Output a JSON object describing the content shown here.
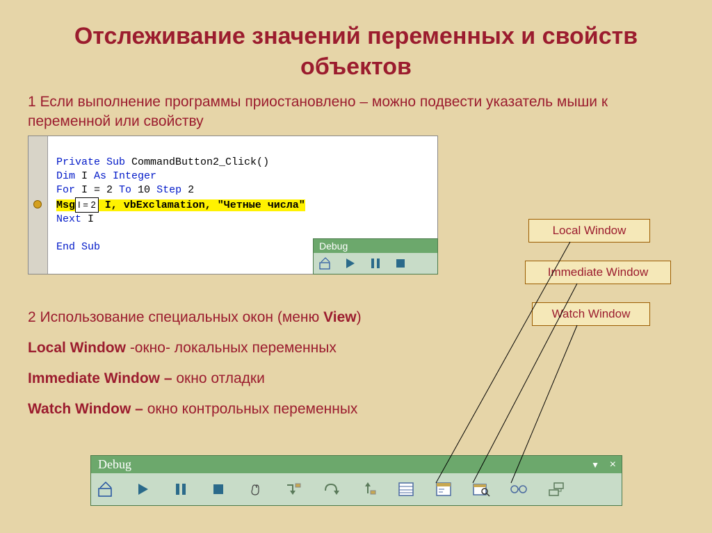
{
  "title": "Отслеживание значений переменных и свойств объектов",
  "para1": "1 Если выполнение программы приостановлено – можно подвести указатель мыши к переменной или свойству",
  "code": {
    "l1a": "Private Sub",
    "l1b": " CommandButton2_Click()",
    "l2a": "Dim",
    "l2b": " I ",
    "l2c": "As Integer",
    "l3a": "For",
    "l3b": " I = 2 ",
    "l3c": "To",
    "l3d": " 10 ",
    "l3e": "Step",
    "l3f": " 2",
    "l4a": "Msg",
    "tooltip": "I = 2",
    "l4b": " I, vbExclamation, \"Четные числа\"",
    "l5a": "Next",
    "l5b": " I",
    "l6": "End Sub"
  },
  "debug_label": "Debug",
  "callouts": {
    "local": "Local Window",
    "immediate": "Immediate Window",
    "watch": "Watch Window"
  },
  "para2": {
    "line1a": "2 Использование специальных окон (меню ",
    "line1b": "View",
    "line1c": ")",
    "line2a": "Local Window",
    "line2b": " -окно- локальных переменных",
    "line3a": "Immediate Window –",
    "line3b": " окно отладки",
    "line4a": "Watch Window –",
    "line4b": " окно контрольных переменных"
  }
}
